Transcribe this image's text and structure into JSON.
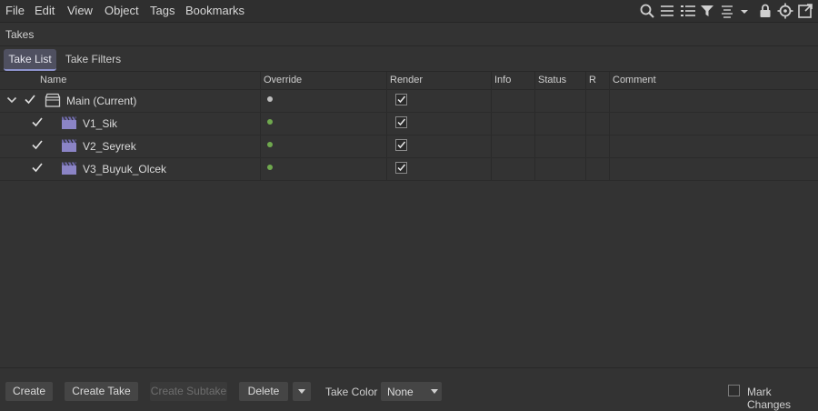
{
  "menubar": {
    "items": [
      "File",
      "Edit",
      "View",
      "Object",
      "Tags",
      "Bookmarks"
    ],
    "icons": [
      "search-icon",
      "list-icon",
      "bullet-list-icon",
      "filter-icon",
      "align-icon",
      "dropdown-icon",
      "lock-icon",
      "target-icon",
      "external-window-icon"
    ]
  },
  "panel": {
    "title": "Takes"
  },
  "tabs": [
    {
      "label": "Take List",
      "active": true
    },
    {
      "label": "Take Filters",
      "active": false
    }
  ],
  "columns": [
    "Name",
    "Override",
    "Render",
    "Info",
    "Status",
    "R",
    "Comment"
  ],
  "rows": [
    {
      "name": "Main (Current)",
      "override_color": "#bdbdbd",
      "render": true,
      "checked": true,
      "expanded": true
    },
    {
      "name": "V1_Sik",
      "override_color": "#6fa84e",
      "render": true,
      "checked": true
    },
    {
      "name": "V2_Seyrek",
      "override_color": "#6fa84e",
      "render": true,
      "checked": true
    },
    {
      "name": "V3_Buyuk_Olcek",
      "override_color": "#6fa84e",
      "render": true,
      "checked": true
    }
  ],
  "bottom": {
    "create": "Create",
    "create_take": "Create Take",
    "create_subtake": "Create Subtake",
    "delete": "Delete",
    "take_color_label": "Take Color",
    "take_color_value": "None",
    "mark_changes": "Mark Changes"
  },
  "colors": {
    "accent": "#8d93cc",
    "tab_active_bg": "#4f5060",
    "take_icon": "#8b84c6"
  }
}
